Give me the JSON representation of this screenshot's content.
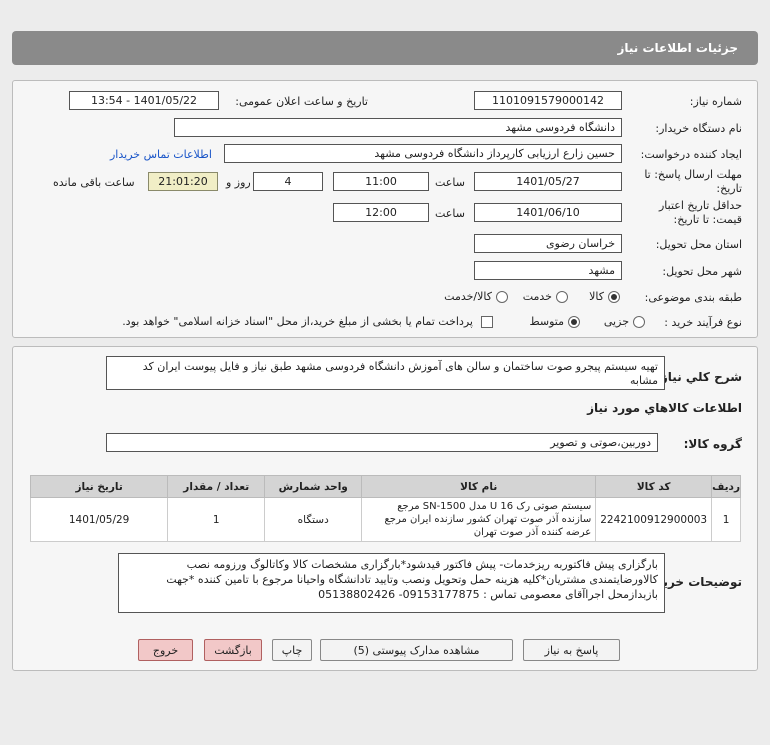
{
  "header": {
    "title": "جزئیات اطلاعات نیاز"
  },
  "form": {
    "need_number_label": "شماره نیاز:",
    "need_number": "1101091579000142",
    "announce_label": "تاریخ و ساعت اعلان عمومی:",
    "announce_value": "1401/05/22 - 13:54",
    "buyer_org_label": "نام دستگاه خریدار:",
    "buyer_org": "دانشگاه فردوسی مشهد",
    "creator_label": "ایجاد کننده درخواست:",
    "creator": "حسین زارع ارزیابی کارپرداز دانشگاه فردوسی مشهد",
    "contact_link": "اطلاعات تماس خریدار",
    "deadline_label_1": "مهلت ارسال پاسخ: تا",
    "deadline_label_2": "تاریخ:",
    "deadline_date": "1401/05/27",
    "time_label": "ساعت",
    "deadline_time": "11:00",
    "days_value": "4",
    "days_label": "روز و",
    "remaining_time": "21:01:20",
    "remaining_label": "ساعت باقی مانده",
    "validity_label_1": "حداقل تاریخ اعتبار",
    "validity_label_2": "قیمت: تا تاریخ:",
    "validity_date": "1401/06/10",
    "validity_time_label": "ساعت",
    "validity_time": "12:00",
    "province_label": "استان محل تحویل:",
    "province": "خراسان رضوی",
    "city_label": "شهر محل تحویل:",
    "city": "مشهد",
    "category_label": "طبقه بندی موضوعی:",
    "category_options": [
      "کالا",
      "خدمت",
      "کالا/خدمت"
    ],
    "process_label": "نوع فرآیند خرید :",
    "process_options": [
      "جزیی",
      "متوسط"
    ],
    "treasury_note": "پرداخت تمام یا بخشی از مبلغ خرید،از محل \"اسناد خزانه اسلامی\" خواهد بود."
  },
  "summary": {
    "label": "شرح کلي نياز:",
    "text": "تهیه سیستم پیجرو صوت ساختمان و سالن های آموزش دانشگاه فردوسی مشهد طبق نیاز و فایل پیوست ایران کد مشابه"
  },
  "goods": {
    "section_title": "اطلاعات کالاهاي مورد نياز",
    "group_label": "گروه کالا:",
    "group_value": "دوربین،صوتی و تصویر",
    "columns": [
      "ردیف",
      "کد کالا",
      "نام کالا",
      "واحد شمارش",
      "تعداد / مقدار",
      "تاریخ نیاز"
    ],
    "rows": [
      {
        "row": "1",
        "code": "2242100912900003",
        "name": "سیستم صوتی رک 16 U مدل SN-1500 مرجع سازنده آذر صوت تهران کشور سازنده ایران مرجع عرضه کننده آذر صوت تهران",
        "unit": "دستگاه",
        "qty": "1",
        "date": "1401/05/29"
      }
    ]
  },
  "buyer_notes": {
    "label": "توضیحات خریدار:",
    "text": "بارگزاری پیش فاکتوربه ریزخدمات- پیش فاکتور قیدشود*بارگزاری مشخصات کالا وکاتالوگ ورزومه نصب کالاورضایتمندی مشتریان*کلیه هزینه حمل وتحویل ونصب وتایید تادانشگاه واحیانا مرجوع با تامین کننده *جهت بازبدازمحل اجراآقای معصومی تماس : 09153177875- 05138802426"
  },
  "buttons": {
    "reply": "پاسخ به نیاز",
    "docs": "مشاهده مدارک پیوستی (5)",
    "print": "چاپ",
    "back": "بازگشت",
    "exit": "خروج"
  },
  "colors": {
    "header_bg": "#8a8a8a",
    "highlight_bg": "#f1eec6",
    "exit_bg": "#f2c8c8",
    "link": "#1a55c8"
  }
}
